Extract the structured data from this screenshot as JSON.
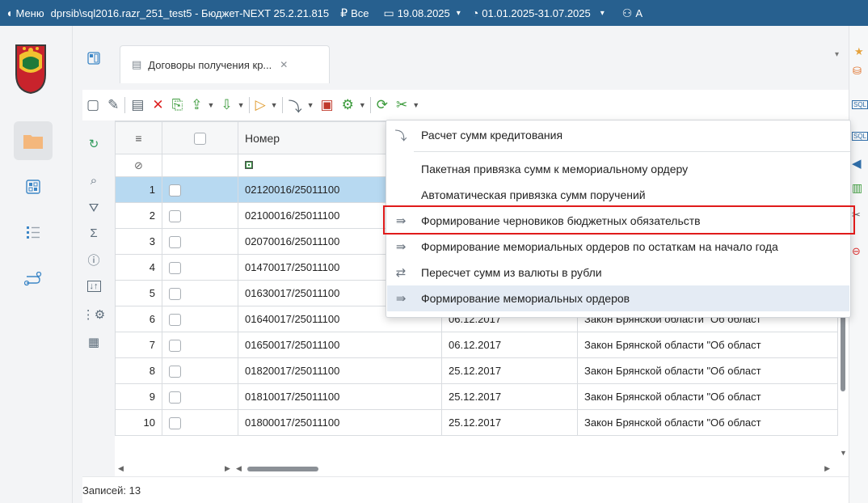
{
  "titlebar": {
    "menu": "Меню",
    "connection": "dprsib\\sql2016.razr_251_test5 - Бюджет-NEXT 25.2.21.815",
    "scope": "Все",
    "date": "19.08.2025",
    "period": "01.01.2025-31.07.2025",
    "user": "А"
  },
  "tab": {
    "title": "Договоры получения кр...",
    "close": "✕"
  },
  "grid": {
    "columns": {
      "menu": "≡",
      "number": "Номер"
    },
    "rows": [
      {
        "n": "1",
        "number": "02120016/25011100",
        "date": "",
        "desc": ""
      },
      {
        "n": "2",
        "number": "02100016/25011100",
        "date": "",
        "desc": ""
      },
      {
        "n": "3",
        "number": "02070016/25011100",
        "date": "",
        "desc": ""
      },
      {
        "n": "4",
        "number": "01470017/25011100",
        "date": "",
        "desc": ""
      },
      {
        "n": "5",
        "number": "01630017/25011100",
        "date": "",
        "desc": ""
      },
      {
        "n": "6",
        "number": "01640017/25011100",
        "date": "06.12.2017",
        "desc": "Закон Брянской области \"Об област"
      },
      {
        "n": "7",
        "number": "01650017/25011100",
        "date": "06.12.2017",
        "desc": "Закон Брянской области \"Об област"
      },
      {
        "n": "8",
        "number": "01820017/25011100",
        "date": "25.12.2017",
        "desc": "Закон Брянской области \"Об област"
      },
      {
        "n": "9",
        "number": "01810017/25011100",
        "date": "25.12.2017",
        "desc": "Закон Брянской области \"Об област"
      },
      {
        "n": "10",
        "number": "01800017/25011100",
        "date": "25.12.2017",
        "desc": "Закон Брянской области \"Об област"
      }
    ]
  },
  "status": {
    "records": "Записей: 13"
  },
  "dropdown": {
    "items": [
      {
        "label": "Расчет сумм кредитования"
      },
      {
        "label": "Пакетная привязка сумм к мемориальному ордеру"
      },
      {
        "label": "Автоматическая привязка сумм поручений"
      },
      {
        "label": "Формирование черновиков бюджетных обязательств"
      },
      {
        "label": "Формирование мемориальных ордеров по остаткам на начало года"
      },
      {
        "label": "Пересчет сумм из валюты в рубли"
      },
      {
        "label": "Формирование мемориальных ордеров"
      }
    ]
  },
  "colors": {
    "titlebar": "#27608f",
    "selected_row": "#b7d9f1",
    "highlight_border": "#e01b1b"
  }
}
